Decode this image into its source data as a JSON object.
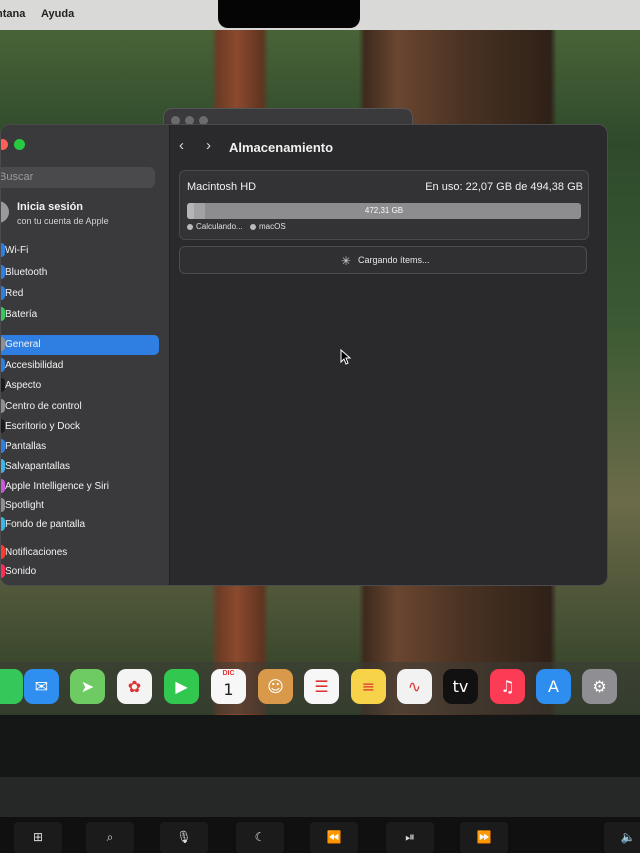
{
  "menubar": {
    "items": [
      "ntana",
      "Ayuda"
    ]
  },
  "sidebar": {
    "search_placeholder": "Buscar",
    "account": {
      "title": "Inicia sesión",
      "subtitle": "con tu cuenta de Apple"
    },
    "items": [
      {
        "label": "Wi-Fi",
        "color": "#2f7fe3"
      },
      {
        "label": "Bluetooth",
        "color": "#2f7fe3"
      },
      {
        "label": "Red",
        "color": "#2f7fe3"
      },
      {
        "label": "Batería",
        "color": "#35c759"
      },
      {
        "label": "General",
        "color": "#8e8e93",
        "active": true
      },
      {
        "label": "Accesibilidad",
        "color": "#2f7fe3"
      },
      {
        "label": "Aspecto",
        "color": "#1c1c1e"
      },
      {
        "label": "Centro de control",
        "color": "#8e8e93"
      },
      {
        "label": "Escritorio y Dock",
        "color": "#1c1c1e"
      },
      {
        "label": "Pantallas",
        "color": "#2f7fe3"
      },
      {
        "label": "Salvapantallas",
        "color": "#3bb6e6"
      },
      {
        "label": "Apple Intelligence y Siri",
        "color": "#c65bd6"
      },
      {
        "label": "Spotlight",
        "color": "#8e8e93"
      },
      {
        "label": "Fondo de pantalla",
        "color": "#3bb6e6"
      },
      {
        "label": "Notificaciones",
        "color": "#ff3b30"
      },
      {
        "label": "Sonido",
        "color": "#ff2d55"
      }
    ]
  },
  "content": {
    "title": "Almacenamiento",
    "disk": {
      "name": "Macintosh HD",
      "usage": "En uso: 22,07 GB de 494,38 GB",
      "free_label": "472,31 GB",
      "used_fraction": 0.045,
      "legend": [
        "Calculando...",
        "macOS"
      ]
    },
    "loading_text": "Cargando ítems..."
  },
  "dock": {
    "apps": [
      {
        "name": "messages-icon",
        "color": "#35c759",
        "glyph": ""
      },
      {
        "name": "mail-icon",
        "color": "#2f8ff0",
        "glyph": "✉"
      },
      {
        "name": "maps-icon",
        "color": "#6ecb63",
        "glyph": "➤"
      },
      {
        "name": "photos-icon",
        "color": "#f4f4f4",
        "glyph": "✿"
      },
      {
        "name": "facetime-icon",
        "color": "#32c850",
        "glyph": "▶"
      },
      {
        "name": "calendar-icon",
        "color": "#f7f7f7",
        "glyph": "1",
        "badge": "DIC"
      },
      {
        "name": "contacts-icon",
        "color": "#d89a4a",
        "glyph": "☺"
      },
      {
        "name": "reminders-icon",
        "color": "#f7f7f7",
        "glyph": "☰"
      },
      {
        "name": "notes-icon",
        "color": "#f7d34a",
        "glyph": "≡"
      },
      {
        "name": "freeform-icon",
        "color": "#f2f2f2",
        "glyph": "∿"
      },
      {
        "name": "apple-tv-icon",
        "color": "#111111",
        "glyph": "tv"
      },
      {
        "name": "music-icon",
        "color": "#fb3c54",
        "glyph": "♫"
      },
      {
        "name": "app-store-icon",
        "color": "#2d8ef0",
        "glyph": "A"
      },
      {
        "name": "system-settings-icon",
        "color": "#8e8e93",
        "glyph": "⚙"
      }
    ]
  },
  "keyboard": {
    "keys": [
      {
        "name": "mission-control-key",
        "glyph": "⊞"
      },
      {
        "name": "spotlight-key",
        "glyph": "⌕"
      },
      {
        "name": "dictation-key",
        "glyph": "🎙"
      },
      {
        "name": "focus-key",
        "glyph": "☾"
      },
      {
        "name": "rewind-key",
        "glyph": "⏪"
      },
      {
        "name": "play-pause-key",
        "glyph": "⏯"
      },
      {
        "name": "fast-forward-key",
        "glyph": "⏩"
      },
      {
        "name": "mute-key",
        "glyph": "🔈"
      }
    ]
  }
}
